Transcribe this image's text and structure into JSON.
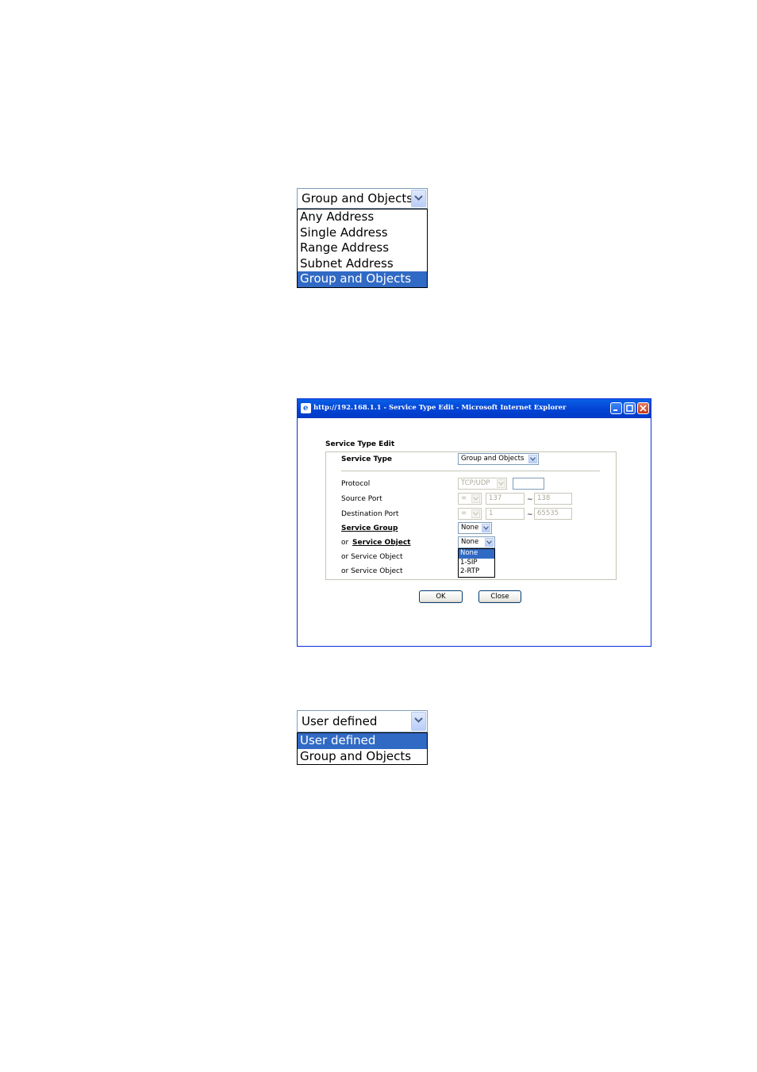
{
  "address_dropdown": {
    "selected": "Group and Objects",
    "options": [
      "Any Address",
      "Single Address",
      "Range Address",
      "Subnet Address",
      "Group and Objects"
    ]
  },
  "ie_window": {
    "title": "http://192.168.1.1 - Service Type Edit - Microsoft Internet Explorer",
    "form_title": "Service Type Edit",
    "service_type_label": "Service Type",
    "service_type_value": "Group and Objects",
    "protocol_label": "Protocol",
    "protocol_value": "TCP/UDP",
    "source_port_label": "Source Port",
    "source_port_op": "=",
    "source_port_start": "137",
    "source_port_end": "138",
    "dest_port_label": "Destination Port",
    "dest_port_op": "=",
    "dest_port_start": "1",
    "dest_port_end": "65535",
    "tilde": "~",
    "service_group_label": "Service Group",
    "service_group_value": "None",
    "or_prefix": "or",
    "service_object_label": "Service Object",
    "service_object_value": "None",
    "service_object_options": [
      "None",
      "1-SIP",
      "2-RTP"
    ],
    "or_service_object_2": "or Service Object",
    "or_service_object_3": "or Service Object",
    "ok_label": "OK",
    "close_label": "Close"
  },
  "type_dropdown": {
    "selected": "User defined",
    "options": [
      "User defined",
      "Group and Objects"
    ]
  },
  "colors": {
    "selection": "#316ac5",
    "titlebar": "#0345d6"
  }
}
